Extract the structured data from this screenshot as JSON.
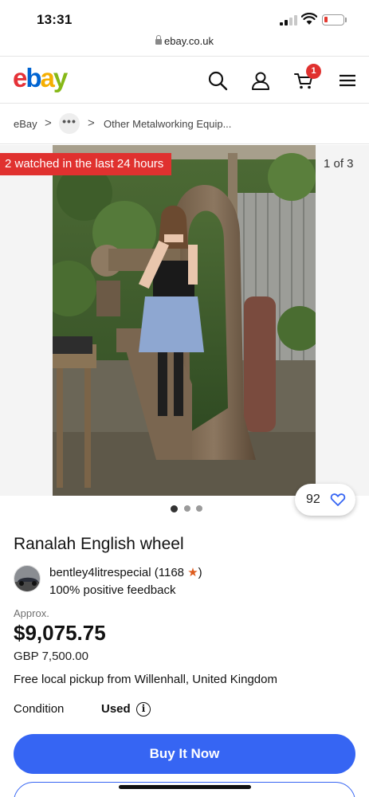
{
  "status_bar": {
    "time": "13:31"
  },
  "browser": {
    "url": "ebay.co.uk"
  },
  "header": {
    "logo_letters": [
      "e",
      "b",
      "a",
      "y"
    ],
    "cart_count": "1",
    "icons": [
      "search-icon",
      "user-icon",
      "cart-icon",
      "menu-icon"
    ]
  },
  "breadcrumb": {
    "home": "eBay",
    "separator": ">",
    "more": "•••",
    "last": "Other Metalworking Equip..."
  },
  "gallery": {
    "watched_banner": "2 watched in the last 24 hours",
    "image_counter": "1 of 3",
    "dots": [
      true,
      false,
      false
    ],
    "watch_count": "92"
  },
  "listing": {
    "title": "Ranalah English wheel",
    "seller_name": "bentley4litrespecial",
    "seller_score": "(1168",
    "seller_star": "★",
    "seller_score_close": ")",
    "seller_feedback": "100% positive feedback",
    "approx_label": "Approx.",
    "price": "$9,075.75",
    "price_gbp": "GBP 7,500.00",
    "pickup": "Free local pickup from Willenhall, United Kingdom",
    "condition_label": "Condition",
    "condition_value": "Used",
    "info_icon_glyph": "i"
  },
  "actions": {
    "buy_now": "Buy It Now"
  },
  "colors": {
    "accent_blue": "#3665f3",
    "badge_red": "#e0312f",
    "logo_red": "#e53238",
    "logo_blue": "#0064d2",
    "logo_yellow": "#f5af02",
    "logo_green": "#86b817"
  }
}
